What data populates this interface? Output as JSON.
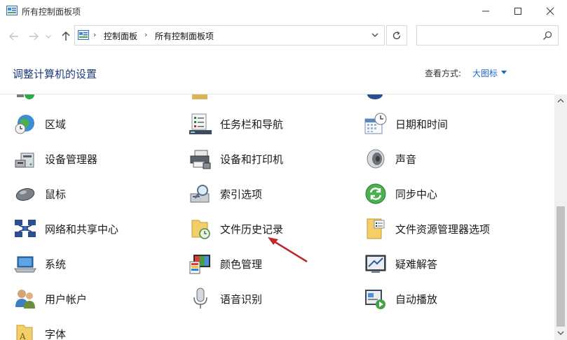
{
  "window": {
    "title": "所有控制面板项",
    "icon": "control-panel-icon",
    "buttons": [
      "minimize-icon",
      "maximize-icon",
      "close-icon"
    ]
  },
  "address": {
    "crumbs": [
      "控制面板",
      "所有控制面板项"
    ],
    "search_placeholder": ""
  },
  "header": {
    "title": "调整计算机的设置",
    "view_by_label": "查看方式:",
    "view_by_value": "大图标"
  },
  "items": [
    {
      "label": "区域",
      "icon": "globe-clock-icon"
    },
    {
      "label": "任务栏和导航",
      "icon": "taskbar-icon"
    },
    {
      "label": "日期和时间",
      "icon": "calendar-clock-icon"
    },
    {
      "label": "设备管理器",
      "icon": "device-manager-icon"
    },
    {
      "label": "设备和打印机",
      "icon": "printer-icon"
    },
    {
      "label": "声音",
      "icon": "speaker-icon"
    },
    {
      "label": "鼠标",
      "icon": "mouse-icon"
    },
    {
      "label": "索引选项",
      "icon": "index-search-icon"
    },
    {
      "label": "同步中心",
      "icon": "sync-icon"
    },
    {
      "label": "网络和共享中心",
      "icon": "network-icon"
    },
    {
      "label": "文件历史记录",
      "icon": "file-history-icon"
    },
    {
      "label": "文件资源管理器选项",
      "icon": "folder-options-icon"
    },
    {
      "label": "系统",
      "icon": "system-laptop-icon"
    },
    {
      "label": "颜色管理",
      "icon": "color-management-icon"
    },
    {
      "label": "疑难解答",
      "icon": "troubleshooting-icon"
    },
    {
      "label": "用户帐户",
      "icon": "user-accounts-icon"
    },
    {
      "label": "语音识别",
      "icon": "microphone-icon"
    },
    {
      "label": "自动播放",
      "icon": "autoplay-icon"
    },
    {
      "label": "字体",
      "icon": "fonts-folder-icon"
    }
  ],
  "colors": {
    "title_blue": "#1e3a78",
    "link_blue": "#1a66cc",
    "arrow_red": "#c0282d"
  }
}
